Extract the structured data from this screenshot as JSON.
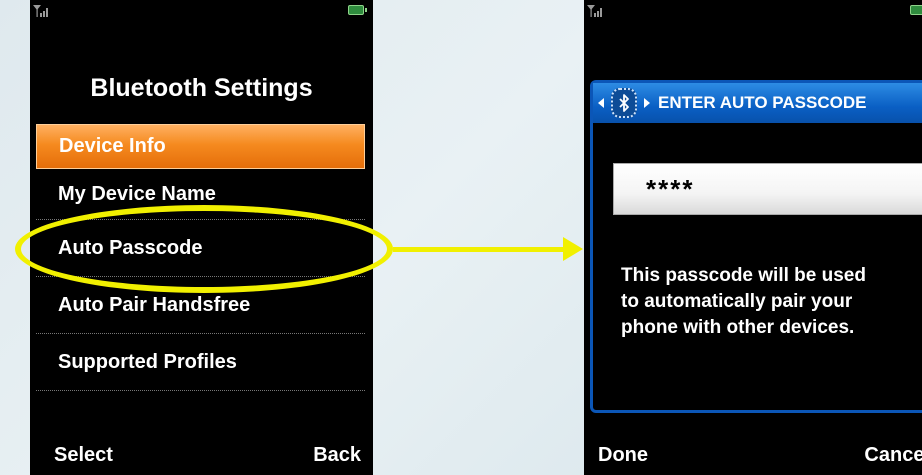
{
  "left_screen": {
    "title": "Bluetooth Settings",
    "menu_items": [
      {
        "label": "Device Info",
        "selected": true
      },
      {
        "label": "My Device Name",
        "selected": false
      },
      {
        "label": "Auto Passcode",
        "selected": false
      },
      {
        "label": "Auto Pair Handsfree",
        "selected": false
      },
      {
        "label": "Supported Profiles",
        "selected": false
      }
    ],
    "softkeys": {
      "left": "Select",
      "right": "Back"
    },
    "icons": {
      "signal": "signal-strength-icon",
      "battery": "battery-icon"
    }
  },
  "right_screen": {
    "dialog_title": "ENTER AUTO PASSCODE",
    "passcode_value": "****",
    "info_lines": [
      "This passcode will be used",
      "to automatically pair your",
      "phone with other devices."
    ],
    "softkeys": {
      "left": "Done",
      "right": "Cancel"
    },
    "icons": {
      "signal": "signal-strength-icon",
      "battery": "battery-icon",
      "bluetooth": "bluetooth-icon"
    }
  },
  "colors": {
    "selected_item": "#f58a1f",
    "dialog_header": "#0a5fc4",
    "highlight": "#f1f000",
    "battery": "#2f8c3e"
  }
}
